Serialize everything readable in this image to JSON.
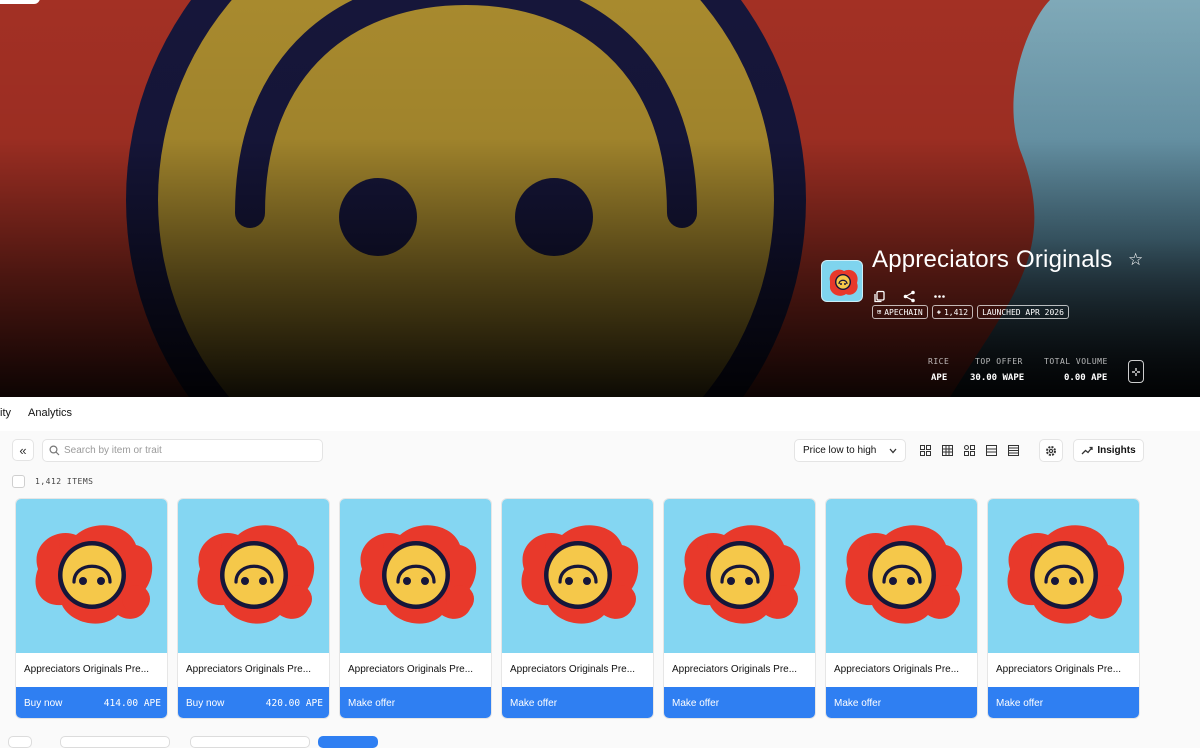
{
  "collection": {
    "title": "Appreciators Originals",
    "badges": [
      {
        "icon": "chain-icon",
        "label": "APECHAIN"
      },
      {
        "icon": "layers-icon",
        "label": "1,412"
      },
      {
        "icon": "",
        "label": "LAUNCHED APR 2026"
      }
    ]
  },
  "stats": [
    {
      "label": "RICE",
      "value": "APE"
    },
    {
      "label": "TOP OFFER",
      "value": "30.00 WAPE"
    },
    {
      "label": "TOTAL VOLUME",
      "value": "0.00 APE"
    }
  ],
  "tabs": [
    {
      "label": "ity"
    },
    {
      "label": "Analytics"
    }
  ],
  "toolbar": {
    "search_placeholder": "Search by item or trait",
    "sort_label": "Price low to high",
    "insights_label": "Insights"
  },
  "items_count": "1,412 ITEMS",
  "items": [
    {
      "name": "Appreciators Originals Pre...",
      "action": "Buy now",
      "price": "414.00 APE"
    },
    {
      "name": "Appreciators Originals Pre...",
      "action": "Buy now",
      "price": "420.00 APE"
    },
    {
      "name": "Appreciators Originals Pre...",
      "action": "Make offer",
      "price": ""
    },
    {
      "name": "Appreciators Originals Pre...",
      "action": "Make offer",
      "price": ""
    },
    {
      "name": "Appreciators Originals Pre...",
      "action": "Make offer",
      "price": ""
    },
    {
      "name": "Appreciators Originals Pre...",
      "action": "Make offer",
      "price": ""
    },
    {
      "name": "Appreciators Originals Pre...",
      "action": "Make offer",
      "price": ""
    }
  ],
  "colors": {
    "accent": "#2f7ff2",
    "card_bg": "#84d6f2",
    "blob": "#e8392b",
    "face": "#f5c84a"
  }
}
